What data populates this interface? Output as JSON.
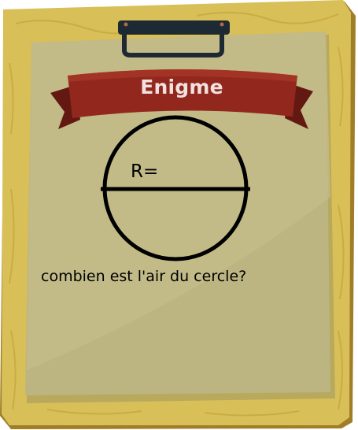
{
  "banner": {
    "title": "Enigme"
  },
  "figure": {
    "shape": "circle-with-diameter",
    "radius_label": "R="
  },
  "question": {
    "text": "combien est l'air du cercle?"
  },
  "colors": {
    "board": "#d8bf55",
    "board_edge": "#b08f31",
    "paper": "#bcb582",
    "paper_light": "#c6bf8d",
    "ribbon": "#92281d",
    "ribbon_dark": "#631811",
    "clip": "#1e2a33",
    "ink": "#000000"
  }
}
